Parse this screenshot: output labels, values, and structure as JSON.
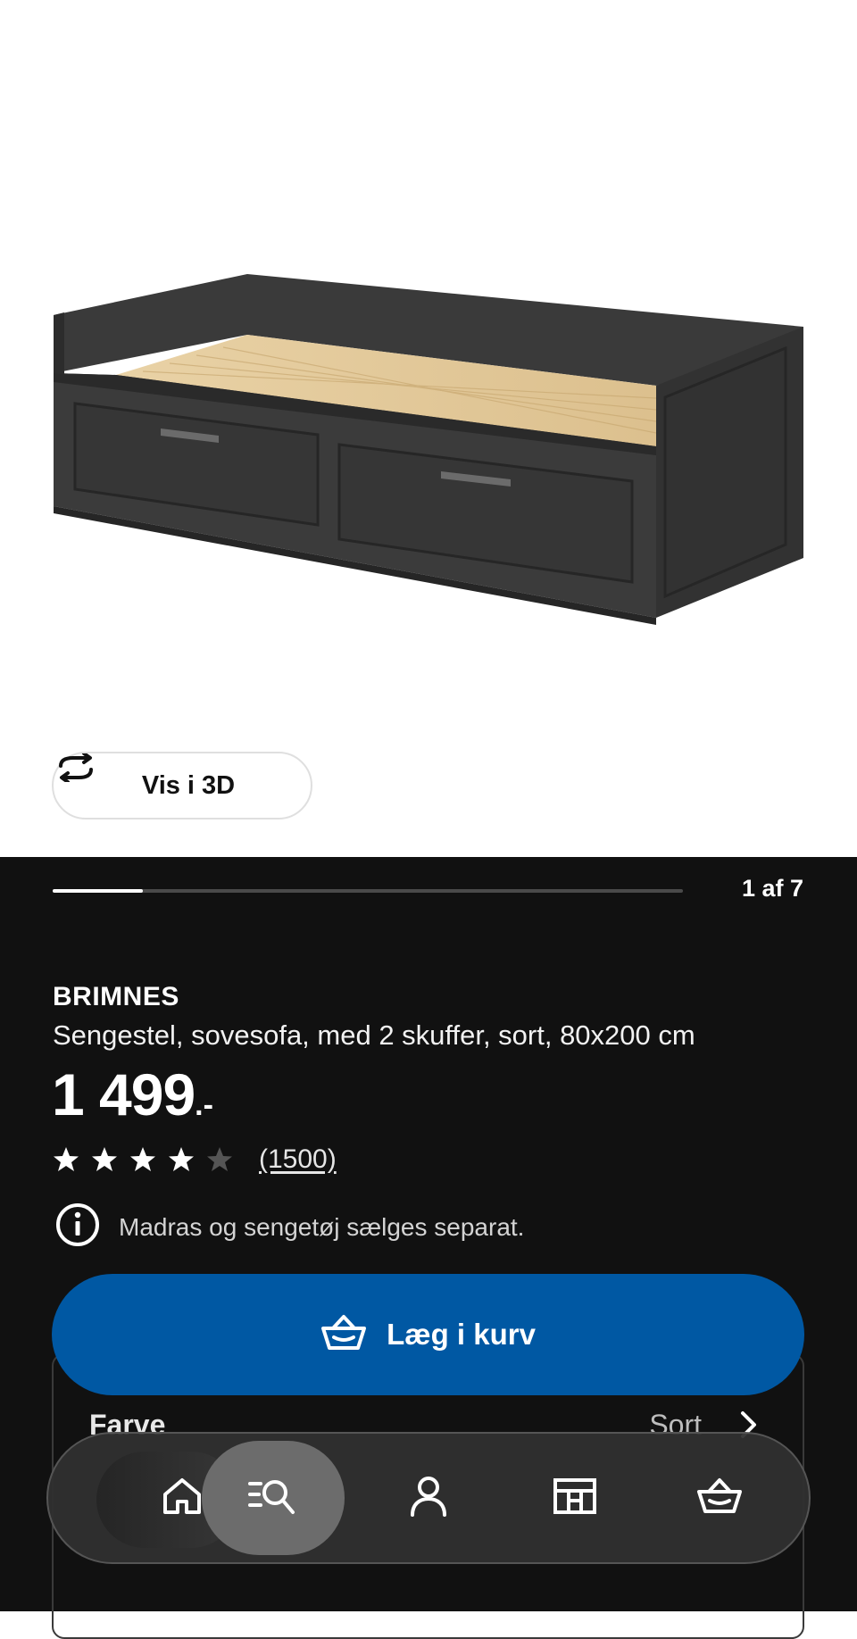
{
  "gallery": {
    "view_3d_label": "Vis i 3D",
    "counter": "1 af 7",
    "progress": 0.142857
  },
  "product": {
    "name": "BRIMNES",
    "description": "Sengestel, sovesofa, med 2 skuffer, sort, 80x200 cm",
    "price": "1 499",
    "price_suffix": ".-",
    "rating_value": 4,
    "rating_max": 5,
    "review_count": "(1500)",
    "info_note": "Madras og sengetøj sælges separat."
  },
  "cart_button": {
    "label": "Læg i kurv",
    "color": "#0058a3"
  },
  "options": {
    "color_label": "Farve",
    "color_value": "Sort"
  },
  "nav": {
    "items": [
      {
        "icon": "home-icon"
      },
      {
        "icon": "search-list-icon",
        "active": true
      },
      {
        "icon": "user-icon"
      },
      {
        "icon": "store-icon"
      },
      {
        "icon": "basket-icon"
      }
    ]
  }
}
